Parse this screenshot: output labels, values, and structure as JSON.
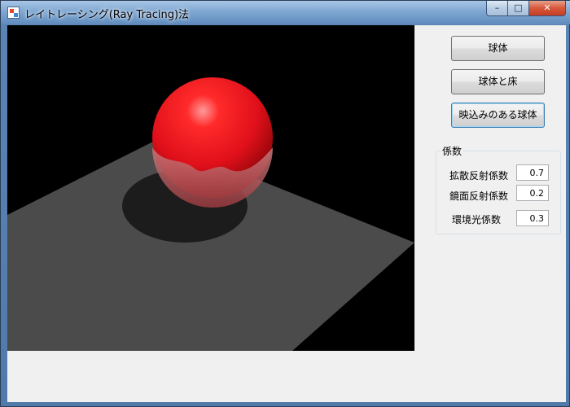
{
  "window": {
    "title": "レイトレーシング(Ray Tracing)法",
    "minimize_glyph": "–",
    "maximize_glyph": "□",
    "close_glyph": "✕"
  },
  "buttons": {
    "sphere": "球体",
    "sphere_floor": "球体と床",
    "reflective_sphere": "映込みのある球体"
  },
  "coefficients": {
    "group_label": "係数",
    "diffuse": {
      "label": "拡散反射係数",
      "value": "0.7"
    },
    "specular": {
      "label": "鏡面反射係数",
      "value": "0.2"
    },
    "ambient": {
      "label": "環境光係数",
      "value": "0.3"
    }
  },
  "scene": {
    "background_color": "#000000",
    "floor_color": "#4b4b4b",
    "shadow_color": "#1c1c1c",
    "sphere_color": "#e8141b"
  }
}
